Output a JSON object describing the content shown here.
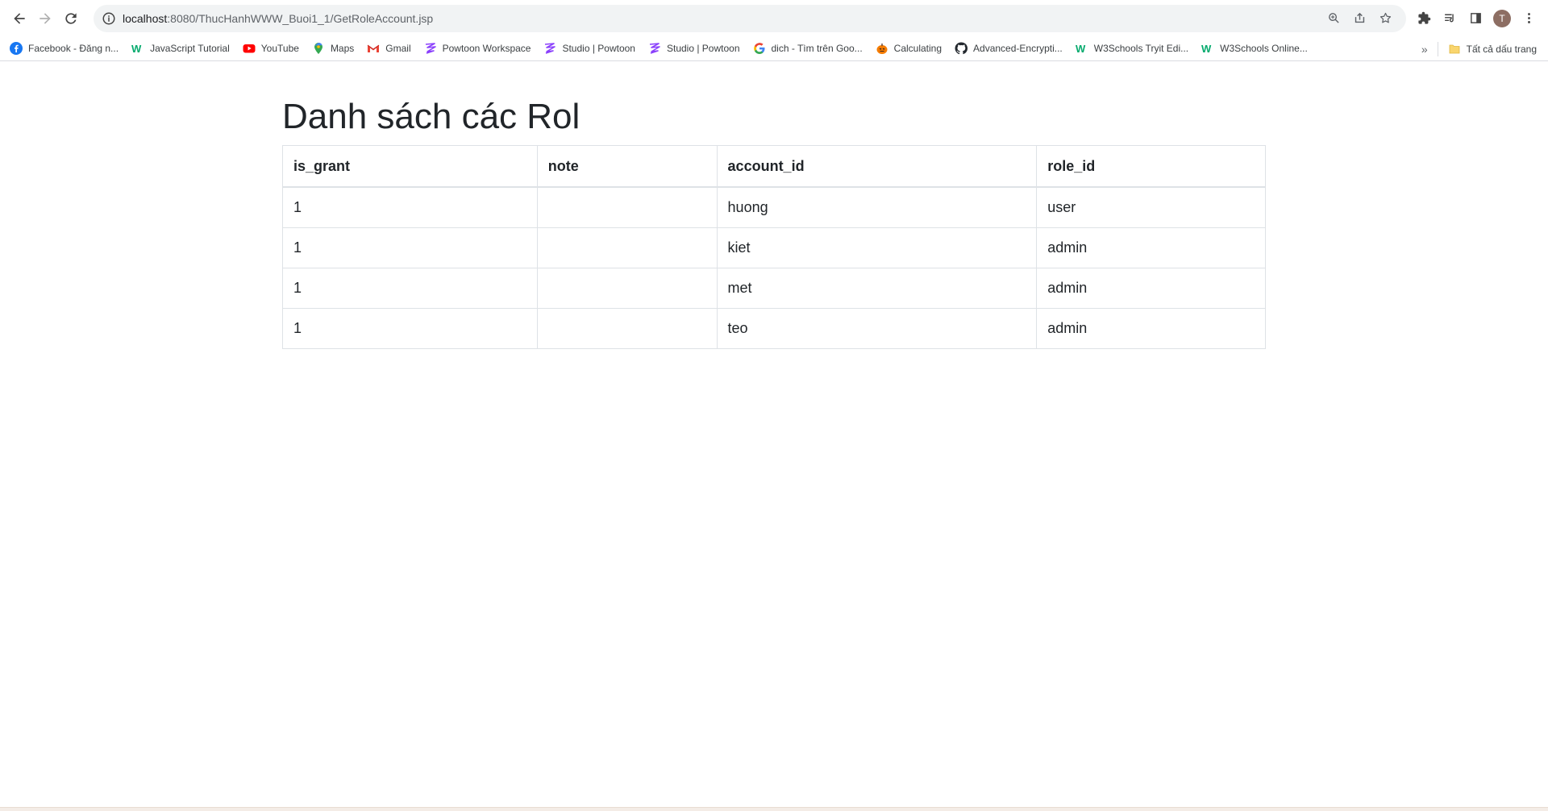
{
  "browser": {
    "url_host": "localhost",
    "url_rest": ":8080/ThucHanhWWW_Buoi1_1/GetRoleAccount.jsp",
    "avatar_letter": "T",
    "bookmarks": [
      {
        "label": "Facebook - Đăng n...",
        "icon": "facebook-icon",
        "color": "#1877f2"
      },
      {
        "label": "JavaScript Tutorial",
        "icon": "w3schools-icon",
        "color": "#04aa6d"
      },
      {
        "label": "YouTube",
        "icon": "youtube-icon",
        "color": "#ff0000"
      },
      {
        "label": "Maps",
        "icon": "maps-icon",
        "color": "#34a853"
      },
      {
        "label": "Gmail",
        "icon": "gmail-icon",
        "color": "#ea4335"
      },
      {
        "label": "Powtoon Workspace",
        "icon": "powtoon-icon",
        "color": "#8a3ffc"
      },
      {
        "label": "Studio | Powtoon",
        "icon": "powtoon-icon",
        "color": "#8a3ffc"
      },
      {
        "label": "Studio | Powtoon",
        "icon": "powtoon-icon",
        "color": "#8a3ffc"
      },
      {
        "label": "dich - Tìm trên Goo...",
        "icon": "google-icon",
        "color": "#4285f4"
      },
      {
        "label": "Calculating",
        "icon": "pumpkin-icon",
        "color": "#f57c00"
      },
      {
        "label": "Advanced-Encrypti...",
        "icon": "github-icon",
        "color": "#24292f"
      },
      {
        "label": "W3Schools Tryit Edi...",
        "icon": "w3schools-icon",
        "color": "#04aa6d"
      },
      {
        "label": "W3Schools Online...",
        "icon": "w3schools-icon",
        "color": "#04aa6d"
      }
    ],
    "more_bookmarks_symbol": "»",
    "all_bookmarks_label": "Tất cả dấu trang"
  },
  "page": {
    "title": "Danh sách các Rol",
    "table": {
      "headers": [
        "is_grant",
        "note",
        "account_id",
        "role_id"
      ],
      "rows": [
        [
          "1",
          "",
          "huong",
          "user"
        ],
        [
          "1",
          "",
          "kiet",
          "admin"
        ],
        [
          "1",
          "",
          "met",
          "admin"
        ],
        [
          "1",
          "",
          "teo",
          "admin"
        ]
      ]
    }
  }
}
